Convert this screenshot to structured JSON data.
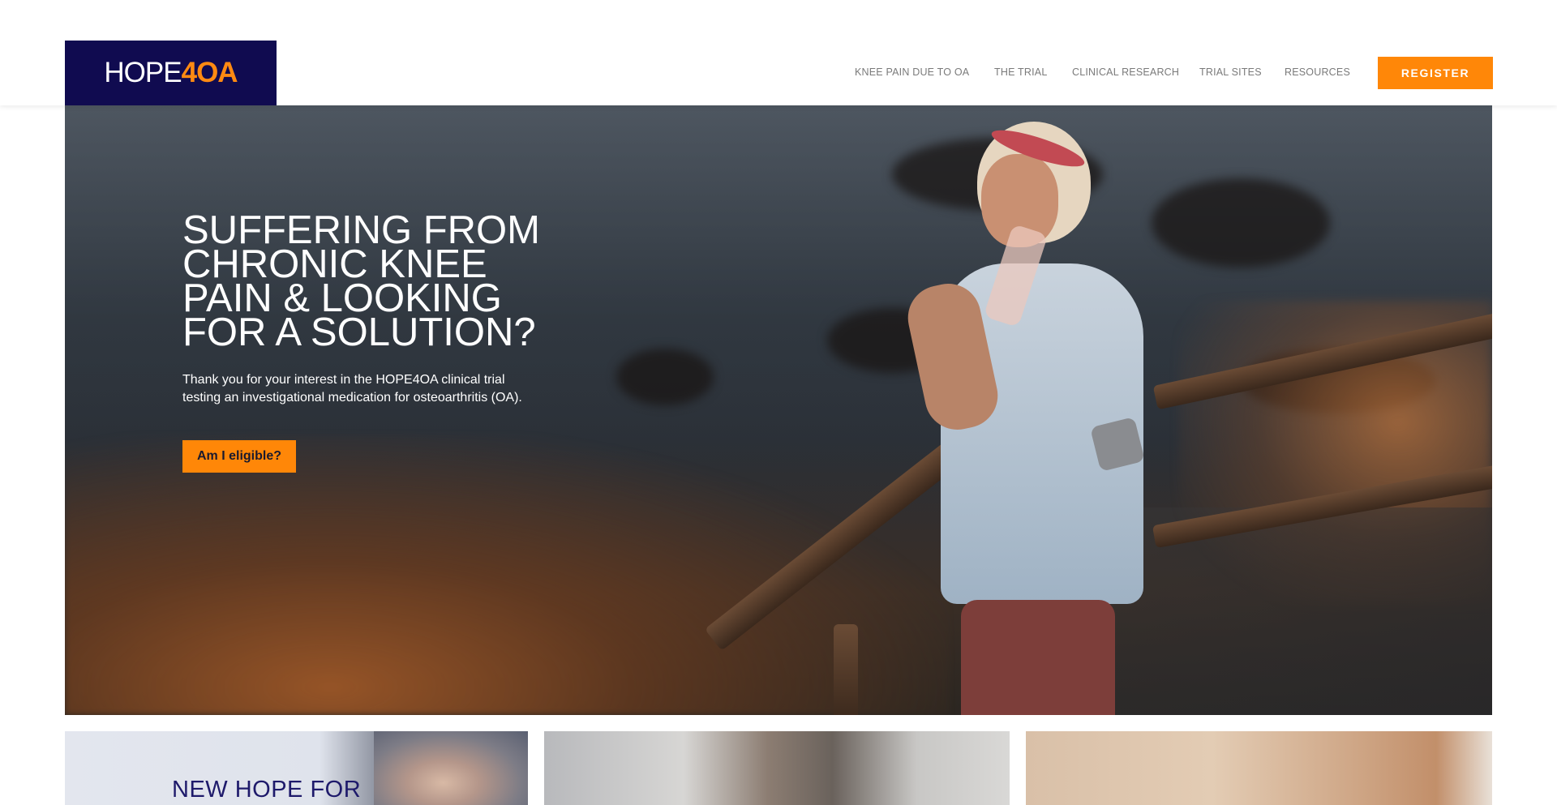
{
  "brand": {
    "logo_part1": "HOPE",
    "logo_part2": "4",
    "logo_part3": "OA",
    "bg_color": "#100b50",
    "accent_color": "#ff8708"
  },
  "nav": {
    "items": [
      {
        "label": "KNEE PAIN DUE TO OA"
      },
      {
        "label": "THE TRIAL"
      },
      {
        "label": "CLINICAL RESEARCH"
      },
      {
        "label": "TRIAL SITES"
      },
      {
        "label": "RESOURCES"
      }
    ],
    "register_label": "REGISTER"
  },
  "hero": {
    "title_lines": [
      "SUFFERING FROM",
      "CHRONIC KNEE",
      "PAIN & LOOKING",
      "FOR A SOLUTION?"
    ],
    "subtitle": "Thank you for your interest in the HOPE4OA clinical trial testing an investigational medication for osteoarthritis (OA).",
    "cta_label": "Am I eligible?"
  },
  "cards": [
    {
      "title": "NEW HOPE FOR"
    }
  ]
}
